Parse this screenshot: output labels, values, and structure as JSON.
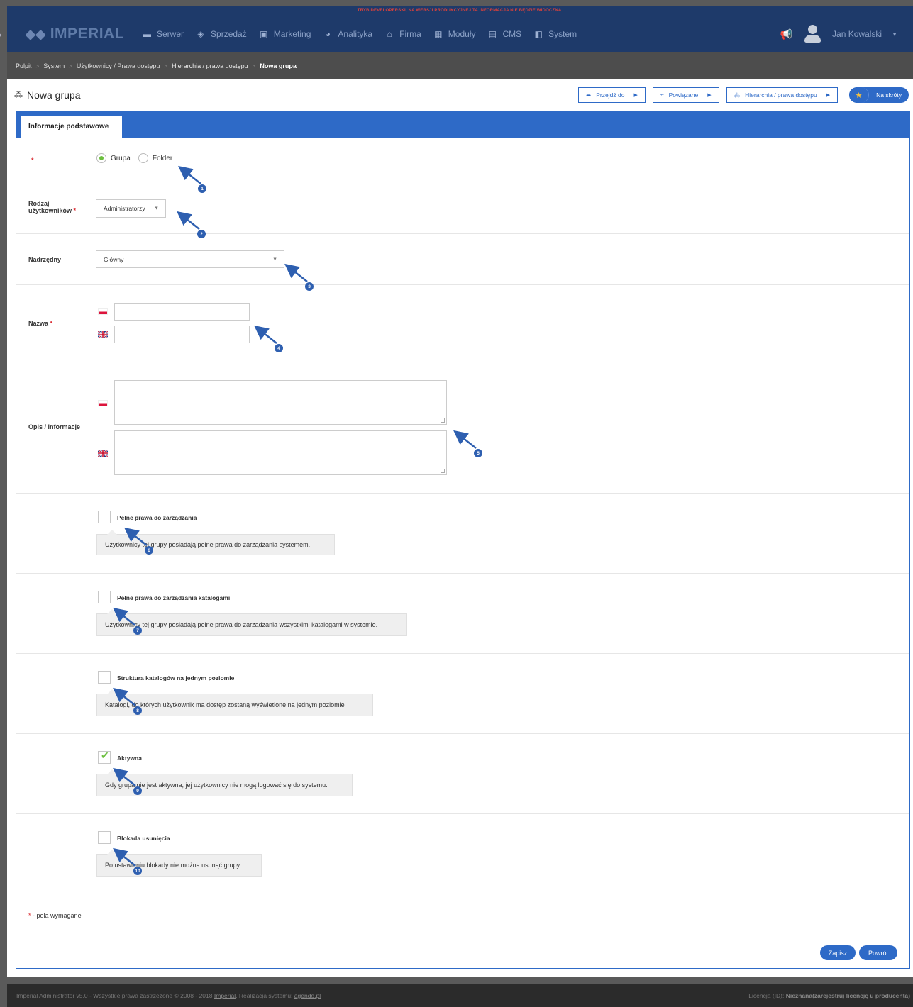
{
  "dev_banner": "TRYB DEVELOPERSKI, NA WERSJI PRODUKCYJNEJ TA INFORMACJA NIE BĘDZIE WIDOCZNA.",
  "logo": "IMPERIAL",
  "nav": [
    {
      "label": "Serwer",
      "icon": "server-icon"
    },
    {
      "label": "Sprzedaż",
      "icon": "box-icon"
    },
    {
      "label": "Marketing",
      "icon": "monitor-icon"
    },
    {
      "label": "Analityka",
      "icon": "chart-icon"
    },
    {
      "label": "Firma",
      "icon": "building-icon"
    },
    {
      "label": "Moduły",
      "icon": "grid-icon"
    },
    {
      "label": "CMS",
      "icon": "window-icon"
    },
    {
      "label": "System",
      "icon": "system-icon"
    }
  ],
  "user": {
    "name": "Jan Kowalski"
  },
  "breadcrumb": {
    "items": [
      "Pulpit",
      "System",
      "Użytkownicy / Prawa dostępu",
      "Hierarchia / prawa dostępu"
    ],
    "current": "Nowa grupa"
  },
  "page": {
    "title": "Nowa grupa",
    "buttons": {
      "goto": "Przejdź do",
      "related": "Powiązane",
      "hierarchy": "Hierarchia / prawa dostępu",
      "shortcuts": "Na skróty"
    }
  },
  "tabs": {
    "basic": "Informacje podstawowe"
  },
  "form": {
    "required_mark": "*",
    "type": {
      "option1": "Grupa",
      "option2": "Folder",
      "selected": "Grupa"
    },
    "user_kind": {
      "label_line1": "Rodzaj",
      "label_line2": "użytkowników",
      "value": "Administratorzy"
    },
    "parent": {
      "label": "Nadrzędny",
      "value": "Główny"
    },
    "name": {
      "label": "Nazwa",
      "pl": "",
      "en": ""
    },
    "desc": {
      "label": "Opis / informacje",
      "pl": "",
      "en": ""
    },
    "checkboxes": [
      {
        "label": "Pełne prawa do zarządzania",
        "hint": "Użytkownicy tej grupy posiadają pełne prawa do zarządzania systemem.",
        "checked": false
      },
      {
        "label": "Pełne prawa do zarządzania katalogami",
        "hint": "Użytkownicy tej grupy posiadają pełne prawa do zarządzania wszystkimi katalogami w systemie.",
        "checked": false
      },
      {
        "label": "Struktura katalogów na jednym poziomie",
        "hint": "Katalogi, do których użytkownik ma dostęp zostaną wyświetlone na jednym poziomie",
        "checked": false
      },
      {
        "label": "Aktywna",
        "hint": "Gdy grupa nie jest aktywna, jej użytkownicy nie mogą logować się do systemu.",
        "checked": true
      },
      {
        "label": "Blokada usunięcia",
        "hint": "Po ustawieniu blokady nie można usunąć grupy",
        "checked": false
      }
    ],
    "required_note": "- pola wymagane",
    "save": "Zapisz",
    "back": "Powrót"
  },
  "markers": [
    "1",
    "2",
    "3",
    "4",
    "5",
    "6",
    "7",
    "8",
    "9",
    "10"
  ],
  "footer": {
    "left_text": "Imperial Administrator v5.0 - Wszystkie prawa zastrzeżone © 2008 - 2018",
    "link1": "Imperial",
    "middle": ". Realizacja systemu:",
    "link2": "agendo.pl",
    "license_label": "Licencja (ID):",
    "license_value": "Nieznana(zarejestruj licencję u producenta)"
  }
}
